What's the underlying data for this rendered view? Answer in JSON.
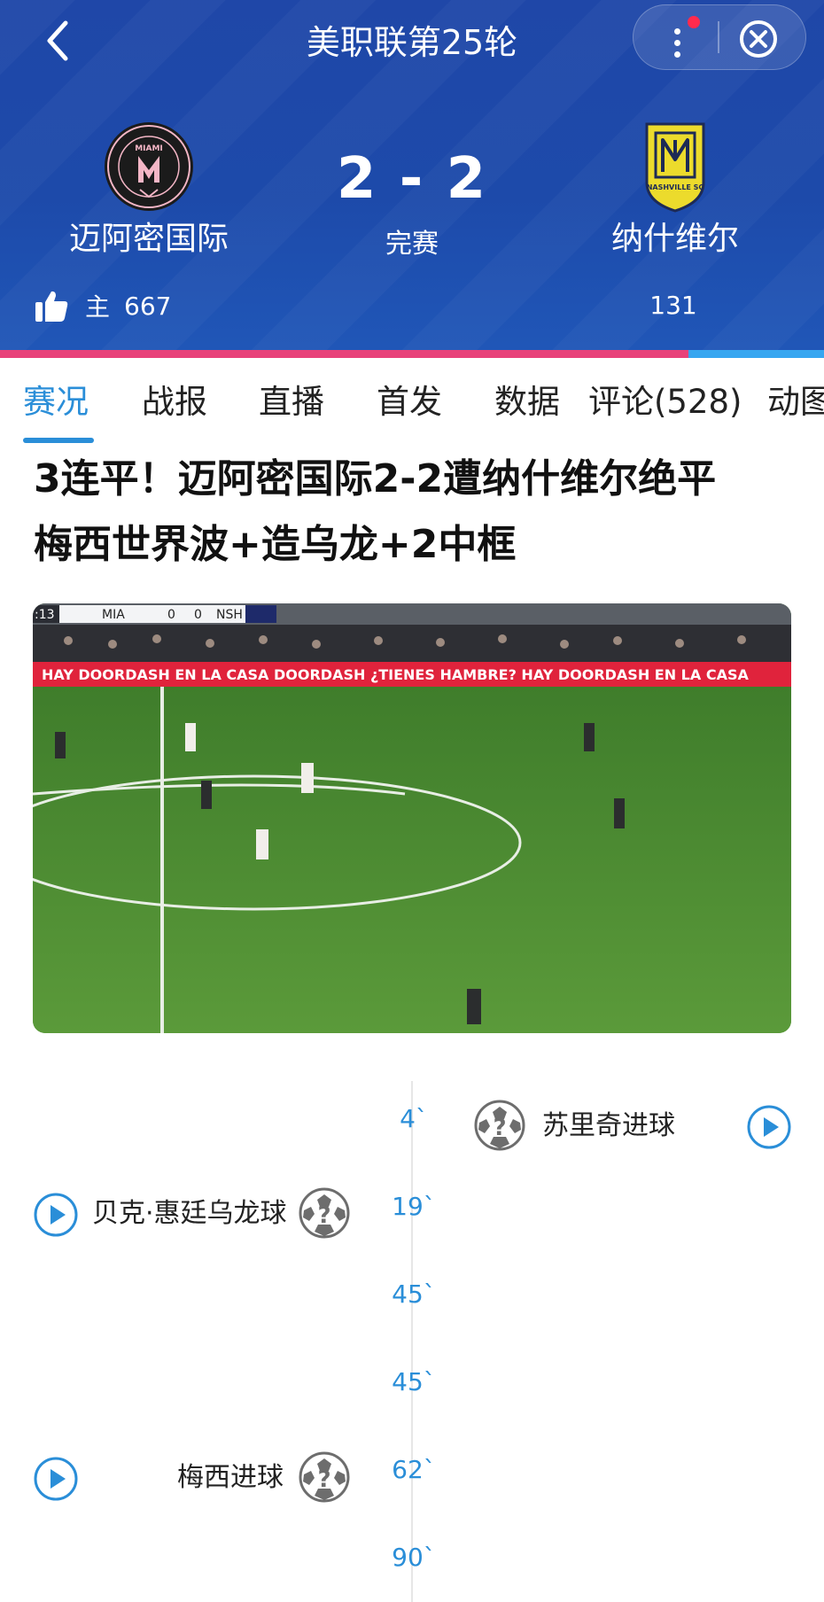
{
  "nav": {
    "title": "美职联第25轮"
  },
  "match": {
    "home_team": "迈阿密国际",
    "away_team": "纳什维尔",
    "score": "2 - 2",
    "status": "完赛",
    "home_logo_text": "MIAMI",
    "away_logo_text": "NASHVILLE SC",
    "home_label": "主",
    "home_likes": "667",
    "away_likes": "131",
    "home_vote_share": 0.835
  },
  "tabs": [
    {
      "label": "赛况",
      "active": true
    },
    {
      "label": "战报"
    },
    {
      "label": "直播"
    },
    {
      "label": "首发"
    },
    {
      "label": "数据"
    },
    {
      "label": "评论(528)"
    },
    {
      "label": "动图"
    }
  ],
  "headline": {
    "line1": "3连平！迈阿密国际2-2遭纳什维尔绝平",
    "line2": "梅西世界波+造乌龙+2中框"
  },
  "video": {
    "time": ":13",
    "home_abbr": "MIA",
    "home_score": "0",
    "away_score": "0",
    "away_abbr": "NSH",
    "banner_text": "HAY DOORDASH EN LA CASA   DOORDASH   ¿TIENES HAMBRE? HAY DOORDASH EN LA CASA"
  },
  "timeline": [
    {
      "minute": "4`",
      "side": "away",
      "text": "苏里奇进球",
      "icon": "soccer-ball-question-icon",
      "has_video": true
    },
    {
      "minute": "19`",
      "side": "home",
      "text": "贝克·惠廷乌龙球",
      "icon": "soccer-ball-question-icon",
      "has_video": true
    },
    {
      "minute": "45`"
    },
    {
      "minute": "45`"
    },
    {
      "minute": "62`",
      "side": "home",
      "text": "梅西进球",
      "icon": "soccer-ball-question-icon",
      "has_video": true
    },
    {
      "minute": "90`"
    }
  ],
  "colors": {
    "header_bg": "#1f47a8",
    "accent_blue": "#2a8ed8",
    "home_vote": "#e8427a",
    "away_vote": "#37a6f0",
    "nashville_yellow": "#ecdb2c"
  }
}
